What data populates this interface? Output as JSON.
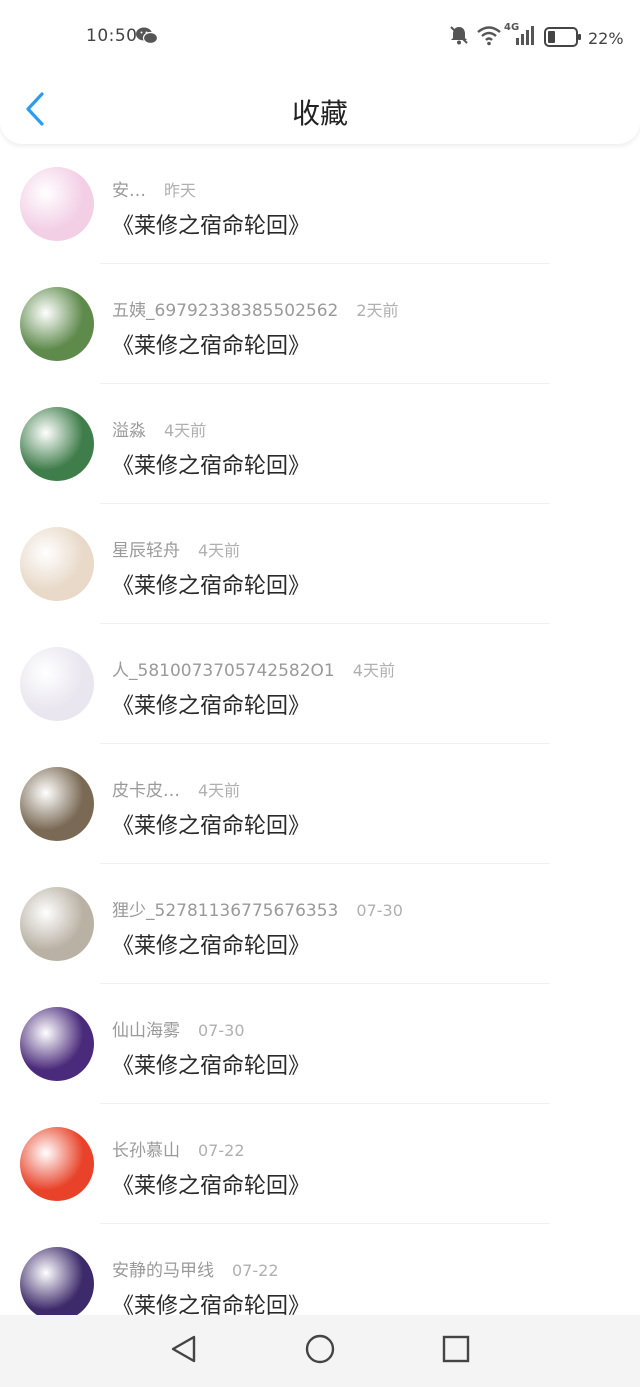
{
  "status": {
    "time": "10:50",
    "network": "4G",
    "battery": "22%"
  },
  "header": {
    "title": "收藏"
  },
  "items": [
    {
      "user": "安…",
      "time": "昨天",
      "book": "《莱修之宿命轮回》",
      "avatar_color": "#f3cfe6"
    },
    {
      "user": "五姨_69792338385502562",
      "time": "2天前",
      "book": "《莱修之宿命轮回》",
      "avatar_color": "#5e8a4c"
    },
    {
      "user": "溢淼",
      "time": "4天前",
      "book": "《莱修之宿命轮回》",
      "avatar_color": "#3f7d4a"
    },
    {
      "user": "星辰轻舟",
      "time": "4天前",
      "book": "《莱修之宿命轮回》",
      "avatar_color": "#e8d9c8"
    },
    {
      "user": "人_5810073705742582O1",
      "time": "4天前",
      "book": "《莱修之宿命轮回》",
      "avatar_color": "#e9e6ef"
    },
    {
      "user": "皮卡皮…",
      "time": "4天前",
      "book": "《莱修之宿命轮回》",
      "avatar_color": "#7a6a55"
    },
    {
      "user": "狸少_52781136775676353",
      "time": "07-30",
      "book": "《莱修之宿命轮回》",
      "avatar_color": "#b9b1a4"
    },
    {
      "user": "仙山海雾",
      "time": "07-30",
      "book": "《莱修之宿命轮回》",
      "avatar_color": "#4a2a7a"
    },
    {
      "user": "长孙慕山",
      "time": "07-22",
      "book": "《莱修之宿命轮回》",
      "avatar_color": "#e8432a"
    },
    {
      "user": "安静的马甲线",
      "time": "07-22",
      "book": "《莱修之宿命轮回》",
      "avatar_color": "#3d2a6a"
    }
  ],
  "colors": {
    "accent": "#2c9cf0",
    "title": "#222222",
    "meta": "#9a9a9a"
  }
}
